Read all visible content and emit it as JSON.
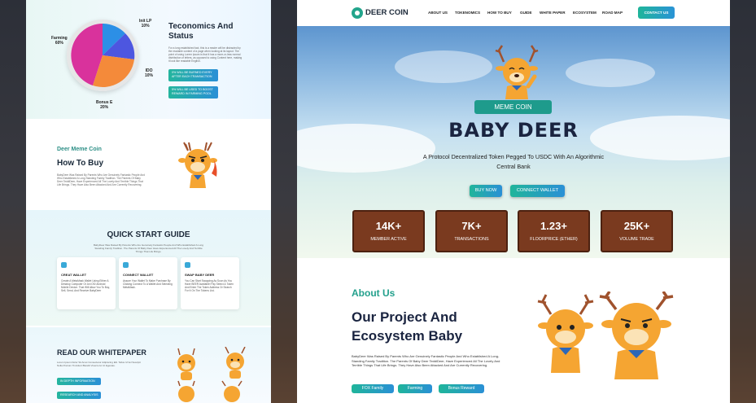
{
  "left": {
    "tokenomics": {
      "title": "Teconomics And Status",
      "paragraph": "For a long established fact, this is a reader will be distracted by the readable content of a page when looking at its layout. The point of using Lorem Ipsum is that it has a more-or-less normal distribution of letters, as opposed to using Content here, making it look like readable English.",
      "buttons": [
        "0% WILL BE BURNED EVERY AFTER EACH TRANSACTION",
        "5% WILL BE USED TO BOOST REWARD IN FARMING POOL"
      ],
      "pie": [
        {
          "name": "Farming",
          "pct": "60%",
          "color": "#d9329c"
        },
        {
          "name": "Init LP",
          "pct": "10%",
          "color": "#2c8fe6"
        },
        {
          "name": "IDO",
          "pct": "10%",
          "color": "#5a4fe0"
        },
        {
          "name": "Bonus E",
          "pct": "20%",
          "color": "#f48a3a"
        }
      ]
    },
    "howtobuy": {
      "eyebrow": "Deer Meme Coin",
      "title": "How To Buy",
      "paragraph": "BabyDeer Was Raised By Parents Who Are Genuinely Fantastic People And Who Established A Long Standing Family Tradition. The Parents Of Baby Deer TeddiDeer, Have Experienced All The Lovely And Terrible Things That Life Brings. They Have Also Been Attacked And Are Currently Recovering."
    },
    "quickstart": {
      "title": "QUICK START GUIDE",
      "paragraph": "BabyDeer Was Raised By Parents Who Are Genuinely Fantastic People And Who Established A Long Standing Family Tradition. The Parents Of Baby Deer Have Experienced All The Lovely And Terrible Things That Life Brings.",
      "cards": [
        {
          "title": "CREAT WALLET",
          "text": "Create A MetaMask Wallet Using Either A Desktop Computer Or An iOS/ Android Mobile Device. That Will Allow You To Buy, Sell, Send, And Receive BabyDeer"
        },
        {
          "title": "CONNECT WALLET",
          "text": "Assure Your Wallet To Make Purchase By Clicking Connect To A Wallet And Selecting MetaMask."
        },
        {
          "title": "SWAP BABY DEER",
          "text": "You Can Start Swapping As Soon As You Have BEER Available! Pay Select & Token And Enter The Token Address Or Search For It On The Tokens List."
        }
      ]
    },
    "whitepaper": {
      "title": "READ OUR WHITEPAPER",
      "paragraph": "Lorem Ipsum Dolor Sit Amet Consectetur Adipiscing Elit. Tellus Id Vel Suscipit Nulla Pretium Tincidunt Blandit Viverra Ac Ut Egestas.",
      "buttons": [
        "IN DEPTH INFORMATION",
        "RESEARCH AND ANALYSIS"
      ]
    }
  },
  "right": {
    "nav": {
      "brand": "DEER COIN",
      "items": [
        "ABOUT US",
        "TOKENOMICS",
        "HOW TO BUY",
        "GUIDE",
        "WHITE PAPER",
        "ECOSYSTEM",
        "ROAD MAP"
      ],
      "contact": "CONTACT US"
    },
    "hero": {
      "badge": "MEME COIN",
      "title": "BABY DEER",
      "description": "A Protocol Decentralized Token Pegged To USDC With An Algorithmic Central Bank",
      "buy": "BUY NOW",
      "connect": "CONNECT WALLET",
      "stats": [
        {
          "value": "14K+",
          "label": "MEMBER ACTIVE"
        },
        {
          "value": "7K+",
          "label": "TRANSACTIONS"
        },
        {
          "value": "1.23+",
          "label": "FLOORPRICE (ETHER)"
        },
        {
          "value": "25K+",
          "label": "VOLUME TRADE"
        }
      ]
    },
    "about": {
      "eyebrow": "About Us",
      "title": "Our Project And Ecosystem Baby",
      "paragraph": "BabyDeer Was Raised By Parents Who Are Genuinely Fantastic People And Who Established A Long-Standing Family Tradition. The Parents Of Baby Deer TeddiDeer, Have Experienced All The Lovely And Terrible Things That Life Brings. They Have Also Been Attacked And Are Currently Recovering.",
      "tags": [
        "FOX Family",
        "Farming",
        "Bonus Reward"
      ]
    }
  }
}
